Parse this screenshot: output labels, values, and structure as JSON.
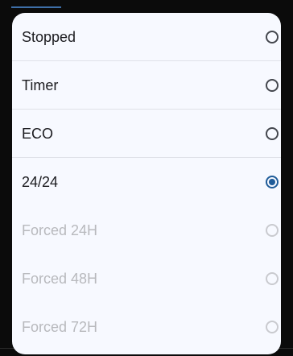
{
  "colors": {
    "accent": "#1f5c99",
    "text": "#1b1b1f",
    "disabled_text": "#b8b9bd",
    "dialog_bg": "#f7f9ff"
  },
  "options": [
    {
      "label": "Stopped",
      "selected": false,
      "enabled": true
    },
    {
      "label": "Timer",
      "selected": false,
      "enabled": true
    },
    {
      "label": "ECO",
      "selected": false,
      "enabled": true
    },
    {
      "label": "24/24",
      "selected": true,
      "enabled": true
    },
    {
      "label": "Forced 24H",
      "selected": false,
      "enabled": false
    },
    {
      "label": "Forced 48H",
      "selected": false,
      "enabled": false
    },
    {
      "label": "Forced 72H",
      "selected": false,
      "enabled": false
    }
  ]
}
